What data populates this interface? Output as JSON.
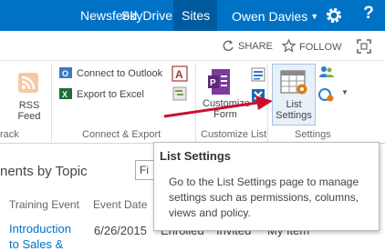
{
  "topbar": {
    "links": [
      "Newsfeed",
      "SkyDrive",
      "Sites"
    ],
    "user_name": "Owen Davies",
    "colors": {
      "bar": "#0072c6",
      "active": "#005a9e"
    },
    "icons": [
      "gear-icon",
      "help-icon"
    ]
  },
  "sharebar": {
    "share_label": "SHARE",
    "follow_label": "FOLLOW",
    "icons": [
      "share-icon",
      "star-icon",
      "focus-icon"
    ]
  },
  "ribbon": {
    "rss_label_1": "RSS",
    "rss_label_2": "Feed",
    "track_group": "rack",
    "connect_outlook": "Connect to Outlook",
    "export_excel": "Export to Excel",
    "connect_export_group": "Connect & Export",
    "customize_form_1": "Customize",
    "customize_form_2": "Form",
    "customize_list_group": "Customize List",
    "list_settings_1": "List",
    "list_settings_2": "Settings",
    "settings_group": "Settings"
  },
  "list_view": {
    "view_title": "nents by Topic",
    "find_placeholder": "Fi",
    "columns": [
      "Training Event",
      "Event Date"
    ],
    "row": {
      "title_line1": "Introduction",
      "title_line2": "to Sales &",
      "date": "6/26/2015",
      "status_1": "Enrolled",
      "status_2": "Invited",
      "status_3": "My Item"
    }
  },
  "tooltip": {
    "title": "List Settings",
    "body": "Go to the List Settings page to manage settings such as permissions, columns, views and policy."
  },
  "annotation": {
    "arrow_color": "#c8102e"
  }
}
